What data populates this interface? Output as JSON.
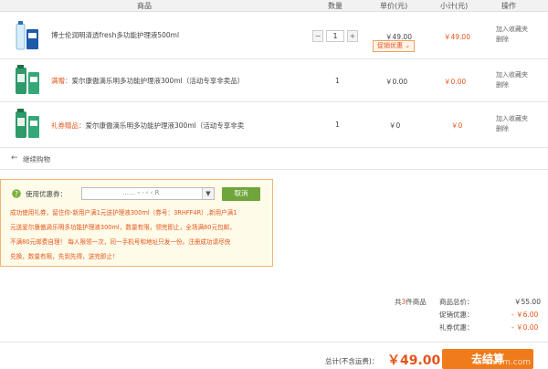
{
  "header": {
    "col_product": "商品",
    "col_qty": "数量",
    "col_unit_price": "单价(元)",
    "col_subtotal": "小计(元)",
    "col_ops": "操作"
  },
  "items": [
    {
      "tag": "",
      "name": "博士伦润明清透fresh多功能护理液500ml",
      "qty": "1",
      "unit_price": "￥49.00",
      "promo_label": "促销优惠",
      "subtotal": "￥49.00",
      "op1": "加入收藏夹",
      "op2": "删除"
    },
    {
      "tag": "满赠：",
      "name": "爱尔康傲滴乐明多功能护理液300ml（活动专享非卖品）",
      "qty": "1",
      "unit_price": "￥0.00",
      "subtotal": "￥0.00",
      "op1": "加入收藏夹",
      "op2": "删除"
    },
    {
      "tag": "礼券赠品：",
      "name": "爱尔康傲滴乐明多功能护理液300ml（活动专享非卖",
      "qty": "1",
      "unit_price": "￥0",
      "subtotal": "￥0",
      "op1": "加入收藏夹",
      "op2": "删除"
    }
  ],
  "continue_shopping": "继续购物",
  "coupon": {
    "label": "使用优惠券：",
    "input_value": "……  ፡፡ ፡ ‹ ‹  R",
    "cancel_label": "取消",
    "message_lines": [
      "成功使用礼券，留住你-新用户满1元送护理液300ml（券号：3RHFF4R）,新用户满1",
      "元送爱尔康傲滴乐明多功能护理液300ml，数量有限，领完即止，全场满80元包邮，",
      "不满80元邮费自理！ 每人限领一次，同一手机号和地址只发一份。注册成功请尽快",
      "兑换，数量有限，先到先得，送完即止！"
    ]
  },
  "summary": {
    "count_prefix": "共",
    "count": "3",
    "count_suffix": "件商品",
    "total_label": "商品总价：",
    "total_value": "￥55.00",
    "promo_label": "促销优惠：",
    "promo_value": "- ￥6.00",
    "coupon_label": "礼券优惠：",
    "coupon_value": "- ￥0.00",
    "grand_label": "总计(不含运费)：",
    "grand_value": "￥49.00",
    "checkout_label": "去结算"
  },
  "watermark": "Lifehium.com",
  "colors": {
    "accent": "#e4551a",
    "checkout": "#f07b1a",
    "cancel_button": "#6fa53b"
  }
}
